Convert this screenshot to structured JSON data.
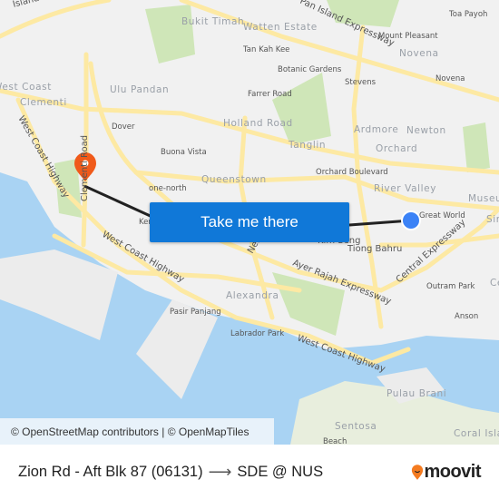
{
  "map": {
    "labels": [
      "Bukit Timah",
      "Watten Estate",
      "Tan Kah Kee",
      "Botanic Gardens",
      "Stevens",
      "Mount Pleasant",
      "Novena",
      "Novena",
      "Toa Payoh",
      "Ulu Pandan",
      "Clementi",
      "West Coast",
      "Farrer Road",
      "Holland Road",
      "Dover",
      "Buona Vista",
      "Tanglin",
      "Ardmore",
      "Newton",
      "Orchard",
      "Orchard Boulevard",
      "River Valley",
      "Queenstown",
      "one-north",
      "Great World",
      "Museum",
      "Sin",
      "Tiong Bahru",
      "Outram Park",
      "Anson",
      "Alexandra",
      "Pasir Panjang",
      "Labrador Park",
      "Pulau Brani",
      "Sentosa",
      "Beach",
      "Coral Island",
      "Kent Ridge",
      "Ce"
    ],
    "road_labels": [
      "Island Expressway",
      "Pan Island Expressway",
      "West Coast Highway",
      "Clementi Road",
      "West Coast Highway",
      "Ayer Rajah Expressway",
      "Central Expressway",
      "West Coast Highway",
      "Nerang",
      "Kim Seng"
    ],
    "colors": {
      "land": "#f1f1f1",
      "water": "#a9d3f3",
      "road": "#fde9a3",
      "park": "#cfe6b8",
      "route": "#222222",
      "origin": "#3b82f6",
      "destination": "#f05a1a",
      "button": "#1078d8"
    }
  },
  "cta": {
    "label": "Take me there"
  },
  "attribution": "© OpenStreetMap contributors | © OpenMapTiles",
  "footer": {
    "origin": "Zion Rd - Aft Blk 87 (06131)",
    "arrow": "⟶",
    "destination": "SDE @ NUS",
    "brand": "moovit"
  }
}
